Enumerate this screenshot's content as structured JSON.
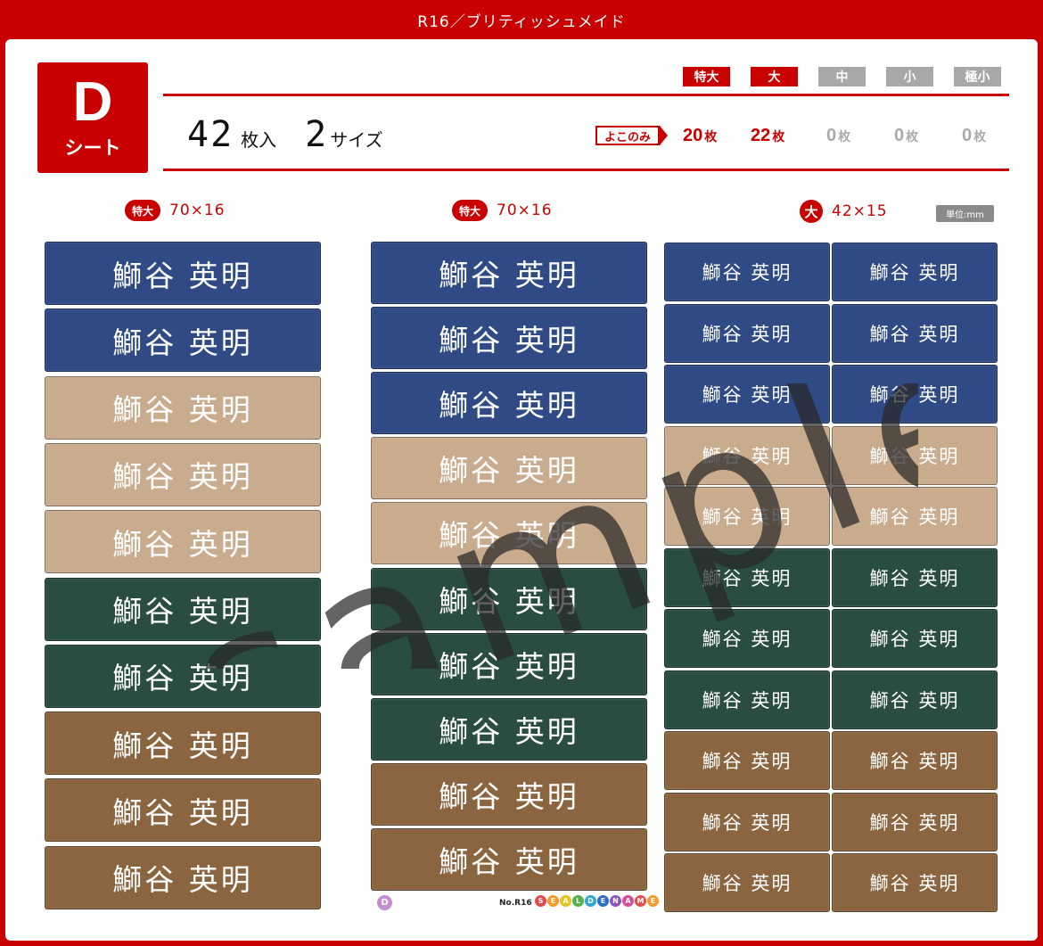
{
  "header": {
    "title": "R16／ブリティッシュメイド"
  },
  "sheet_badge": {
    "letter": "D",
    "label": "シート"
  },
  "summary": {
    "count": "42",
    "count_unit": "枚入",
    "sizes": "2",
    "sizes_unit": "サイズ"
  },
  "size_tags": [
    {
      "label": "特大",
      "active": true
    },
    {
      "label": "大",
      "active": true
    },
    {
      "label": "中",
      "active": false
    },
    {
      "label": "小",
      "active": false
    },
    {
      "label": "極小",
      "active": false
    }
  ],
  "orientation": {
    "label": "よこのみ"
  },
  "quantities": [
    {
      "value": "20",
      "unit": "枚",
      "active": true
    },
    {
      "value": "22",
      "unit": "枚",
      "active": true
    },
    {
      "value": "0",
      "unit": "枚",
      "active": false
    },
    {
      "value": "0",
      "unit": "枚",
      "active": false
    },
    {
      "value": "0",
      "unit": "枚",
      "active": false
    }
  ],
  "columns": [
    {
      "size_label": "特大",
      "dimensions": "70×16"
    },
    {
      "size_label": "特大",
      "dimensions": "70×16"
    },
    {
      "size_label": "大",
      "dimensions": "42×15"
    }
  ],
  "unit_note": "単位:mm",
  "label_text": "鰤谷 英明",
  "palette": {
    "navy": "#2f4a85",
    "beige": "#c9ab8e",
    "green": "#2a4d42",
    "brown": "#8b6540",
    "accent": "#c80000"
  },
  "col1_colors": [
    "navy",
    "navy",
    "beige",
    "beige",
    "beige",
    "green",
    "green",
    "brown",
    "brown",
    "brown"
  ],
  "col2_colors": [
    "navy",
    "navy",
    "navy",
    "beige",
    "beige",
    "green",
    "green",
    "green",
    "brown",
    "brown"
  ],
  "col3_colors": [
    "navy",
    "navy",
    "navy",
    "beige",
    "beige",
    "green",
    "green",
    "green",
    "brown",
    "brown",
    "brown"
  ],
  "watermark": "sample",
  "footer": {
    "sheet_mark": "D",
    "product_no": "No.R16",
    "brand_letters": [
      "S",
      "E",
      "A",
      "L",
      "D",
      "E",
      "N",
      "A",
      "M",
      "E"
    ]
  }
}
